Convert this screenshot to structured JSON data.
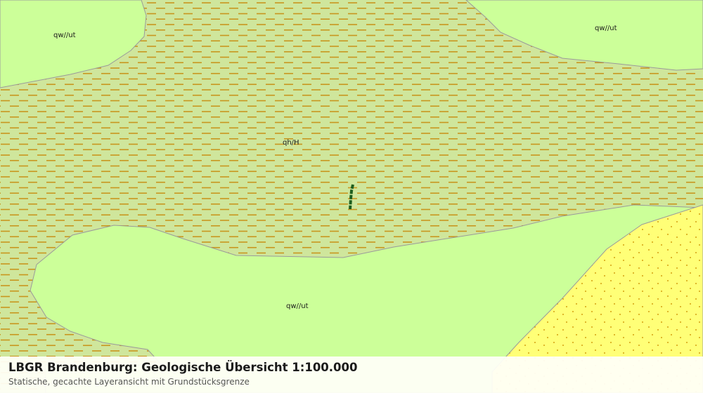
{
  "map": {
    "colors": {
      "peat_fill": "#cfe69c",
      "peat_hatch": "#c8961e",
      "valley_sand_fill": "#ccff99",
      "sand_fill": "#ffff77",
      "sand_dots": "#d4a010",
      "boundary": "#9a9a9a",
      "parcel_line": "#1f5f1f"
    },
    "units": [
      {
        "code": "qw//ut",
        "pattern": "plain"
      },
      {
        "code": "qw//ut",
        "pattern": "plain"
      },
      {
        "code": "qh/H",
        "pattern": "dashed-hatch"
      },
      {
        "code": "qw//ut",
        "pattern": "plain"
      },
      {
        "code": "",
        "pattern": "dotted"
      }
    ]
  },
  "footer": {
    "title": "LBGR Brandenburg: Geologische Übersicht 1:100.000",
    "subtitle": "Statische, gecachte Layeransicht mit Grundstücksgrenze"
  }
}
